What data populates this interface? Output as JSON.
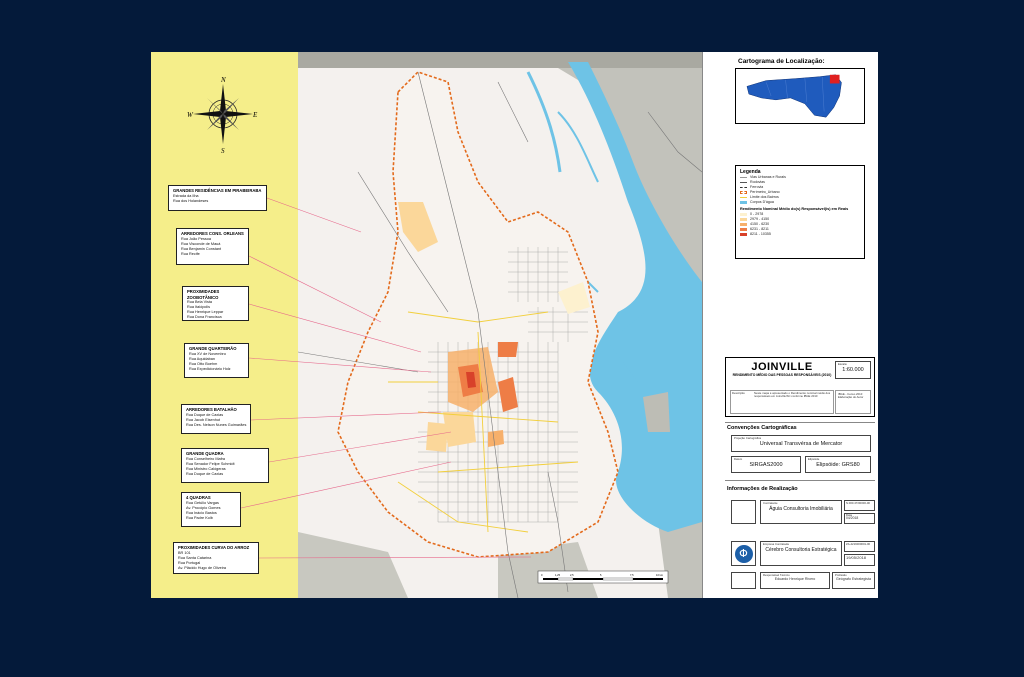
{
  "compass": {
    "n": "N",
    "s": "S",
    "e": "E",
    "w": "W"
  },
  "callouts": [
    {
      "title": "GRANDES RESIDÊNCIAS EM PIRABEIRABA",
      "lines": [
        "Estrada da Ilha",
        "Rua dos Holandeses"
      ]
    },
    {
      "title": "ARREDORES CONS. ORLEANS",
      "lines": [
        "Rua João Pessoa",
        "Rua Visconde de Mauá",
        "Rua Benjamin Constant",
        "Rua Recife"
      ]
    },
    {
      "title": "PROXIMIDADES ZOOBOTÂNICO",
      "lines": [
        "Rua Bela Vista",
        "Rua Itaiópolis",
        "Rua Henrique Leppar",
        "Rua Dona Francisca"
      ]
    },
    {
      "title": "GRANDE QUARTEIRÃO",
      "lines": [
        "Rua XV de Novembro",
        "Rua Aquidaban",
        "Rua Otto Boehm",
        "Rua Expedicionário Holz"
      ]
    },
    {
      "title": "ARREDORES BATALHÃO",
      "lines": [
        "Rua Duque de Caxias",
        "Rua Jacob Eisenhut",
        "Rua Des. Nelson Nunes Guimarães"
      ]
    },
    {
      "title": "GRANDE QUADRA",
      "lines": [
        "Rua Conselheiro Mafra",
        "Rua Senador Felipe Schmidt",
        "Rua Ministro Calógeras",
        "Rua Duque de Caxias"
      ]
    },
    {
      "title": "4 QUADRAS",
      "lines": [
        "Rua Getúlio Vargas",
        "Av. Procópio Gomes",
        "Rua Inácio Bastos",
        "Rua Padre Kolb"
      ]
    },
    {
      "title": "PROXIMIDADES CURVA DO ARROZ",
      "lines": [
        "BR 101",
        "Rua Santa Catarina",
        "Rua Portugal",
        "Av. Plácido Hugo de Oliveira"
      ]
    }
  ],
  "scale_bar": {
    "labels": [
      "0",
      "1,25",
      "2,5",
      "5",
      "7,5",
      "10 km"
    ]
  },
  "location_map": {
    "title": "Cartograma de Localização:"
  },
  "legend": {
    "title": "Legenda",
    "items": [
      "Vias Urbanas e Rurais",
      "Rodovias",
      "Ferrovia",
      "Perímetro_Urbano",
      "Limite dos Bairros",
      "Corpos D'água"
    ],
    "income_title": "Rendimento Nominal Médio do(s) Responsável(is) em Reais",
    "classes": [
      "0 - 2978",
      "2979 - 4150",
      "4150 - 6230",
      "6231 - 8211",
      "8211 - 10355"
    ],
    "colors": [
      "#fdf1cf",
      "#fbd79a",
      "#f7b06b",
      "#ee7d46",
      "#d8412a"
    ]
  },
  "title_block": {
    "city": "JOINVILLE",
    "subtitle": "RENDIMENTO MÉDIO DAS PESSOAS RESPONSÁVEIS (2010)",
    "scale_label": "Escala:",
    "scale": "1:60.000",
    "desc_label": "Descrição:",
    "desc": "Neste mapa é apresentado o Rendimento nominal médio dos responsáveis em Joinville/SC conforme IBGE 2010",
    "source": "IBGE - Censo 2010 Elaboração do Autor"
  },
  "conventions": {
    "title": "Convenções Cartográficas",
    "projection_label": "Projeção Cartográfica",
    "projection": "Universal Transvérsa de Mercator",
    "datum_label": "Datum",
    "datum": "SIRGAS2000",
    "ellipsoid_label": "Elipsóide",
    "ellipsoid": "Elipsóide: GRS80"
  },
  "realization": {
    "title": "Informações de Realização",
    "contractor_label": "Contratante",
    "contractor": "Águia Consultoria Imobiliária",
    "date1_label": "Data",
    "date1": "04/2018",
    "code1": "N.000.47/00000-00",
    "company_label": "Empresa Contratada",
    "company": "Cérebro Consultoria Estratégica",
    "code2": "ZA-4219000001-00",
    "date2": "19/05/2018",
    "resp_label": "Responsável Técnico",
    "resp": "Eduardo Henrique Rivero",
    "prof_label": "Profissão",
    "prof": "Geógrafo Estrategista",
    "logo_letter": "Φ"
  },
  "colors": {
    "background": "#041a3a",
    "water": "#6ec3e6",
    "urban_fill": "#f7f3ef",
    "perimeter": "#e36a1b",
    "band": "#f5ee8a"
  }
}
